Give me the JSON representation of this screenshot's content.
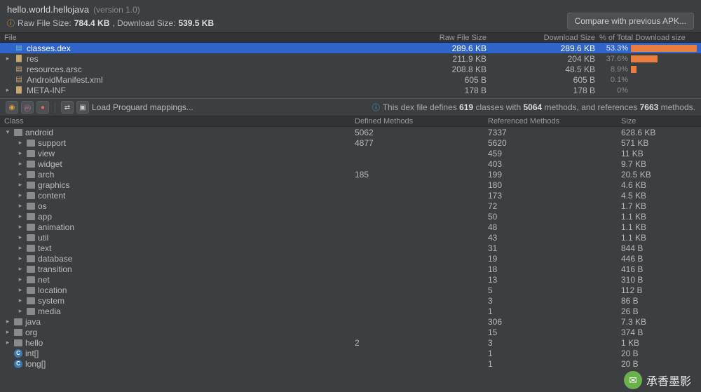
{
  "header": {
    "package": "hello.world.hellojava",
    "version": "(version 1.0)",
    "raw_label": "Raw File Size:",
    "raw_value": "784.4 KB",
    "dl_label": ", Download Size:",
    "dl_value": "539.5 KB",
    "compare_btn": "Compare with previous APK..."
  },
  "file_table": {
    "headers": {
      "file": "File",
      "raw": "Raw File Size",
      "dl": "Download Size",
      "pct": "% of Total Download size"
    },
    "rows": [
      {
        "indent": 0,
        "chev": "",
        "icon": "dex",
        "name": "classes.dex",
        "raw": "289.6 KB",
        "dl": "289.6 KB",
        "pct": "53.3%",
        "bar": 100,
        "selected": true
      },
      {
        "indent": 0,
        "chev": "▸",
        "icon": "folder",
        "name": "res",
        "raw": "211.9 KB",
        "dl": "204 KB",
        "pct": "37.6%",
        "bar": 40
      },
      {
        "indent": 0,
        "chev": "",
        "icon": "arsc",
        "name": "resources.arsc",
        "raw": "208.8 KB",
        "dl": "48.5 KB",
        "pct": "8.9%",
        "bar": 8
      },
      {
        "indent": 0,
        "chev": "",
        "icon": "xml",
        "name": "AndroidManifest.xml",
        "raw": "605 B",
        "dl": "605 B",
        "pct": "0.1%",
        "bar": 0
      },
      {
        "indent": 0,
        "chev": "▸",
        "icon": "folder",
        "name": "META-INF",
        "raw": "178 B",
        "dl": "178 B",
        "pct": "0%",
        "bar": 0
      }
    ]
  },
  "toolbar": {
    "load_mappings": "Load Proguard mappings...",
    "info_prefix": "This dex file defines ",
    "classes": "619",
    "mid1": " classes with ",
    "methods": "5064",
    "mid2": " methods, and references ",
    "refs": "7663",
    "suffix": " methods."
  },
  "class_table": {
    "headers": {
      "name": "Class",
      "def": "Defined Methods",
      "ref": "Referenced Methods",
      "size": "Size"
    },
    "rows": [
      {
        "d": 0,
        "c": "▾",
        "i": "pkg",
        "n": "android",
        "def": "5062",
        "ref": "7337",
        "sz": "628.6 KB"
      },
      {
        "d": 1,
        "c": "▸",
        "i": "pkg",
        "n": "support",
        "def": "4877",
        "ref": "5620",
        "sz": "571 KB"
      },
      {
        "d": 1,
        "c": "▸",
        "i": "pkg",
        "n": "view",
        "def": "",
        "ref": "459",
        "sz": "11 KB"
      },
      {
        "d": 1,
        "c": "▸",
        "i": "pkg",
        "n": "widget",
        "def": "",
        "ref": "403",
        "sz": "9.7 KB"
      },
      {
        "d": 1,
        "c": "▸",
        "i": "pkg",
        "n": "arch",
        "def": "185",
        "ref": "199",
        "sz": "20.5 KB"
      },
      {
        "d": 1,
        "c": "▸",
        "i": "pkg",
        "n": "graphics",
        "def": "",
        "ref": "180",
        "sz": "4.6 KB"
      },
      {
        "d": 1,
        "c": "▸",
        "i": "pkg",
        "n": "content",
        "def": "",
        "ref": "173",
        "sz": "4.5 KB"
      },
      {
        "d": 1,
        "c": "▸",
        "i": "pkg",
        "n": "os",
        "def": "",
        "ref": "72",
        "sz": "1.7 KB"
      },
      {
        "d": 1,
        "c": "▸",
        "i": "pkg",
        "n": "app",
        "def": "",
        "ref": "50",
        "sz": "1.1 KB"
      },
      {
        "d": 1,
        "c": "▸",
        "i": "pkg",
        "n": "animation",
        "def": "",
        "ref": "48",
        "sz": "1.1 KB"
      },
      {
        "d": 1,
        "c": "▸",
        "i": "pkg",
        "n": "util",
        "def": "",
        "ref": "43",
        "sz": "1.1 KB"
      },
      {
        "d": 1,
        "c": "▸",
        "i": "pkg",
        "n": "text",
        "def": "",
        "ref": "31",
        "sz": "844 B"
      },
      {
        "d": 1,
        "c": "▸",
        "i": "pkg",
        "n": "database",
        "def": "",
        "ref": "19",
        "sz": "446 B"
      },
      {
        "d": 1,
        "c": "▸",
        "i": "pkg",
        "n": "transition",
        "def": "",
        "ref": "18",
        "sz": "416 B"
      },
      {
        "d": 1,
        "c": "▸",
        "i": "pkg",
        "n": "net",
        "def": "",
        "ref": "13",
        "sz": "310 B"
      },
      {
        "d": 1,
        "c": "▸",
        "i": "pkg",
        "n": "location",
        "def": "",
        "ref": "5",
        "sz": "112 B"
      },
      {
        "d": 1,
        "c": "▸",
        "i": "pkg",
        "n": "system",
        "def": "",
        "ref": "3",
        "sz": "86 B"
      },
      {
        "d": 1,
        "c": "▸",
        "i": "pkg",
        "n": "media",
        "def": "",
        "ref": "1",
        "sz": "26 B"
      },
      {
        "d": 0,
        "c": "▸",
        "i": "pkg",
        "n": "java",
        "def": "",
        "ref": "306",
        "sz": "7.3 KB"
      },
      {
        "d": 0,
        "c": "▸",
        "i": "pkg",
        "n": "org",
        "def": "",
        "ref": "15",
        "sz": "374 B"
      },
      {
        "d": 0,
        "c": "▸",
        "i": "pkg",
        "n": "hello",
        "def": "2",
        "ref": "3",
        "sz": "1 KB"
      },
      {
        "d": 0,
        "c": "",
        "i": "cls",
        "n": "int[]",
        "def": "",
        "ref": "1",
        "sz": "20 B"
      },
      {
        "d": 0,
        "c": "",
        "i": "cls",
        "n": "long[]",
        "def": "",
        "ref": "1",
        "sz": "20 B"
      }
    ]
  },
  "watermark": {
    "text": "承香墨影"
  }
}
